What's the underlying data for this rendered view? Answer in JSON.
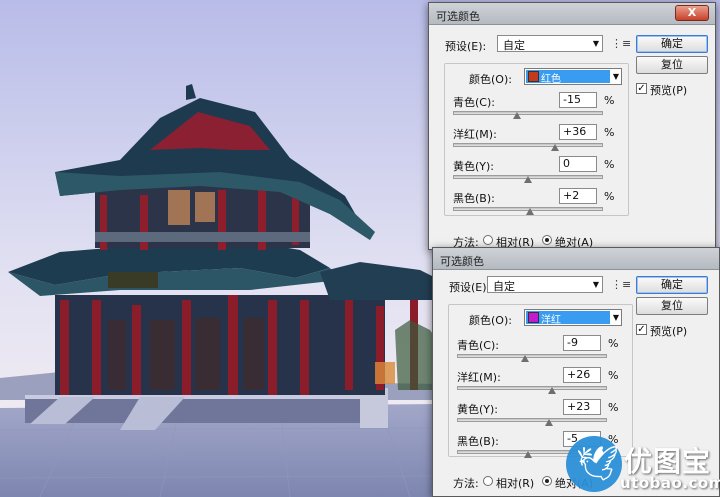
{
  "colors": {
    "sky_top": "#b9bde9",
    "sky_bottom": "#f3eff4",
    "roof": "#1d3a4f",
    "pillar": "#8b1d2a",
    "ground": "#8d95b8",
    "select_blue": "#3a9cf0",
    "watermark": "#2a8fd6"
  },
  "dialog1": {
    "title": "可选颜色",
    "close_label": "X",
    "preset_label": "预设(E):",
    "preset_value": "自定",
    "color_label": "颜色(O):",
    "color_value": "红色",
    "color_swatch": "#c5391c",
    "sliders": [
      {
        "label": "青色(C):",
        "value": "-15",
        "unit": "%",
        "level": -15
      },
      {
        "label": "洋红(M):",
        "value": "+36",
        "unit": "%",
        "level": 36
      },
      {
        "label": "黄色(Y):",
        "value": "0",
        "unit": "%",
        "level": 0
      },
      {
        "label": "黑色(B):",
        "value": "+2",
        "unit": "%",
        "level": 2
      }
    ],
    "method_label": "方法:",
    "method_relative": "相对(R)",
    "method_absolute": "绝对(A)",
    "ok_label": "确定",
    "reset_label": "复位",
    "preview_label": "预览(P)",
    "preview_checked": true
  },
  "dialog2": {
    "title": "可选颜色",
    "preset_label": "预设(E):",
    "preset_value": "自定",
    "color_label": "颜色(O):",
    "color_value": "洋红",
    "color_swatch": "#c21bd0",
    "sliders": [
      {
        "label": "青色(C):",
        "value": "-9",
        "unit": "%",
        "level": -9
      },
      {
        "label": "洋红(M):",
        "value": "+26",
        "unit": "%",
        "level": 26
      },
      {
        "label": "黄色(Y):",
        "value": "+23",
        "unit": "%",
        "level": 23
      },
      {
        "label": "黑色(B):",
        "value": "-5",
        "unit": "%",
        "level": -5
      }
    ],
    "method_label": "方法:",
    "method_relative": "相对(R)",
    "method_absolute": "绝对(A)",
    "ok_label": "确定",
    "reset_label": "复位",
    "preview_label": "预览(P)",
    "preview_checked": true
  },
  "watermark": {
    "name": "优图宝",
    "url": "utobao.com",
    "icon": "bird-icon"
  }
}
